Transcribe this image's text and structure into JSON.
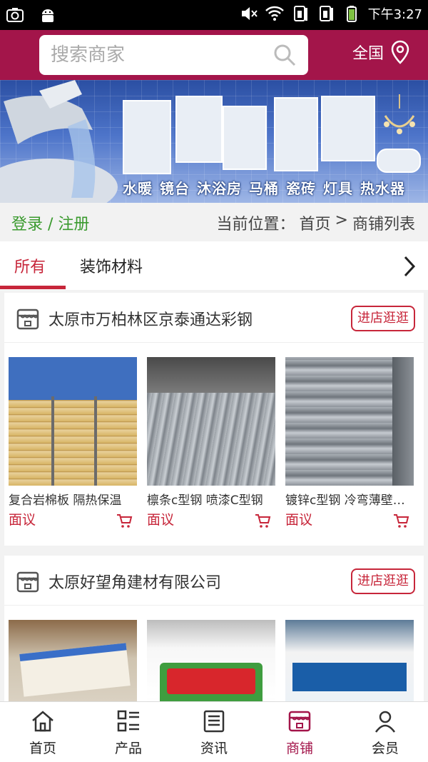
{
  "status_bar": {
    "time": "下午3:27",
    "icons": [
      "camera-icon",
      "android-icon",
      "mute-icon",
      "wifi-icon",
      "sim1-icon",
      "sim2-icon",
      "battery-icon"
    ]
  },
  "header": {
    "search_placeholder": "搜索商家",
    "region_label": "全国",
    "accent_color": "#a3154a"
  },
  "banner": {
    "categories": [
      "水暖",
      "镜台",
      "沐浴房",
      "马桶",
      "瓷砖",
      "灯具",
      "热水器"
    ]
  },
  "breadcrumb": {
    "login_label": "登录 / 注册",
    "prefix": "当前位置：",
    "home": "首页",
    "separator": ">",
    "current": "商铺列表"
  },
  "tabs": [
    {
      "label": "所有",
      "active": true
    },
    {
      "label": "装饰材料",
      "active": false
    }
  ],
  "shops": [
    {
      "name": "太原市万柏林区京泰通达彩钢",
      "visit_label": "进店逛逛",
      "products": [
        {
          "name": "复合岩棉板 隔热保温",
          "price": "面议"
        },
        {
          "name": "檩条c型钢 喷漆C型钢",
          "price": "面议"
        },
        {
          "name": "镀锌c型钢 冷弯薄壁型钢",
          "price": "面议"
        }
      ]
    },
    {
      "name": "太原好望角建材有限公司",
      "visit_label": "进店逛逛",
      "products": [
        {
          "name": "",
          "price": ""
        },
        {
          "name": "",
          "price": ""
        },
        {
          "name": "",
          "price": ""
        }
      ]
    }
  ],
  "bottom_nav": [
    {
      "label": "首页",
      "icon": "home-icon",
      "active": false
    },
    {
      "label": "产品",
      "icon": "list-icon",
      "active": false
    },
    {
      "label": "资讯",
      "icon": "news-icon",
      "active": false
    },
    {
      "label": "商铺",
      "icon": "shop-icon",
      "active": true
    },
    {
      "label": "会员",
      "icon": "user-icon",
      "active": false
    }
  ],
  "colors": {
    "brand": "#a3154a",
    "price_red": "#c7263a",
    "login_green": "#3a9a2e"
  }
}
